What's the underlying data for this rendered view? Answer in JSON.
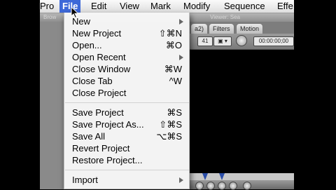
{
  "menubar": {
    "items": [
      {
        "label": "Pro"
      },
      {
        "label": "File",
        "selected": true
      },
      {
        "label": "Edit"
      },
      {
        "label": "View"
      },
      {
        "label": "Mark"
      },
      {
        "label": "Modify"
      },
      {
        "label": "Sequence"
      },
      {
        "label": "Effe"
      }
    ],
    "accent_color": "#3d68d8"
  },
  "background_window": {
    "title_left": "Brow",
    "title_center": "Viewer: Sea",
    "tabs": [
      {
        "label": "a2)"
      },
      {
        "label": "Filters"
      },
      {
        "label": "Motion"
      }
    ],
    "zoom_value": "41",
    "timecode": "00:00:00;00"
  },
  "file_menu": {
    "items": [
      {
        "label": "New",
        "submenu": true
      },
      {
        "label": "New Project",
        "shortcut": "⇧⌘N"
      },
      {
        "label": "Open...",
        "shortcut": "⌘O"
      },
      {
        "label": "Open Recent",
        "submenu": true
      },
      {
        "label": "Close Window",
        "shortcut": "⌘W"
      },
      {
        "label": "Close Tab",
        "shortcut": "^W"
      },
      {
        "label": "Close Project"
      },
      {
        "label": "Save Project",
        "shortcut": "⌘S"
      },
      {
        "label": "Save Project As...",
        "shortcut": "⇧⌘S"
      },
      {
        "label": "Save All",
        "shortcut": "⌥⌘S"
      },
      {
        "label": "Revert Project"
      },
      {
        "label": "Restore Project..."
      },
      {
        "label": "Import",
        "submenu": true
      }
    ]
  }
}
